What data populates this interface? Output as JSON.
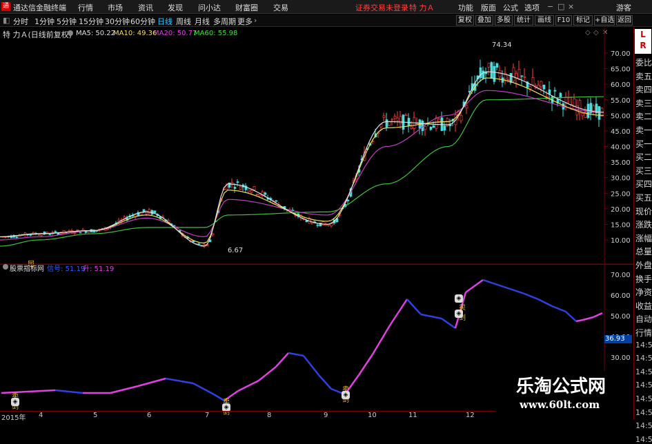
{
  "menubar": {
    "app_title": "通达信金融终端",
    "items": [
      "行情",
      "市场",
      "资讯",
      "发现",
      "问小达",
      "财富圈",
      "交易"
    ],
    "login_status": "证券交易未登录",
    "stock_name": "特 力Ａ",
    "right_items": [
      "功能",
      "版面",
      "公式",
      "选项"
    ],
    "guest": "游客"
  },
  "toolbar": {
    "periods": [
      "分时",
      "1分钟",
      "5分钟",
      "15分钟",
      "30分钟",
      "60分钟",
      "日线",
      "周线",
      "月线",
      "多周期",
      "更多"
    ],
    "active_period": "日线",
    "right_buttons": [
      "复权",
      "叠加",
      "多股",
      "统计",
      "画线",
      "F10",
      "标记",
      "+自选",
      "返回"
    ]
  },
  "main_chart": {
    "title": "特 力Ａ(日线前复权)",
    "ma_labels": [
      {
        "text": "MA5: 50.22",
        "color": "#e0e0e0"
      },
      {
        "text": "MA10: 49.36",
        "color": "#f0e060"
      },
      {
        "text": "MA20: 50.77",
        "color": "#e040e0"
      },
      {
        "text": "MA60: 55.98",
        "color": "#40e040"
      }
    ],
    "y_ticks": [
      "70.00",
      "65.00",
      "60.00",
      "55.00",
      "50.00",
      "45.00",
      "40.00",
      "35.00",
      "30.00",
      "25.00",
      "20.00",
      "15.00",
      "10.00"
    ],
    "high_label": "74.34",
    "low_label": "6.67",
    "marker": "屈"
  },
  "indicator": {
    "title": "股票指标网",
    "line1": "信号: 51.19",
    "line2": "升: 51.19",
    "y_ticks": [
      "70.00",
      "60.00",
      "50.00",
      "40.00",
      "30.00"
    ],
    "current_value": "36.93",
    "buy_label": "买",
    "sell_label": "卖剑"
  },
  "right_panel": {
    "items": [
      "委比",
      "卖五",
      "卖四",
      "卖三",
      "卖二",
      "卖一",
      "买一",
      "买二",
      "买三",
      "买四",
      "买五",
      "现价",
      "涨跌",
      "涨幅",
      "总量",
      "外盘",
      "换手",
      "净资",
      "收益",
      "自动",
      "行情",
      "14:5",
      "14:5",
      "14:5",
      "14:5",
      "14:5",
      "14:5",
      "14:5",
      "14:5"
    ],
    "logo_letter": "L",
    "logo_letter2": "R"
  },
  "x_axis": {
    "labels": [
      "2015年",
      "4",
      "5",
      "6",
      "7",
      "8",
      "9",
      "10",
      "11",
      "12"
    ]
  },
  "watermark": {
    "line1": "乐淘公式网",
    "line2": "www.60lt.com"
  },
  "colors": {
    "up": "#ff4040",
    "down": "#40e0e0",
    "ma5": "#e0e0e0",
    "ma10": "#f0e060",
    "ma20": "#c040c0",
    "ma60": "#40c040",
    "ind_up": "#e040e0",
    "ind_down": "#3040e0",
    "axis": "#7a0000"
  },
  "chart_data": {
    "type": "line",
    "title": "特 力Ａ(日线前复权)",
    "x": [
      "2015年",
      "4",
      "5",
      "6",
      "7",
      "8",
      "9",
      "10",
      "11",
      "12"
    ],
    "series": [
      {
        "name": "MA5",
        "values": [
          11,
          12,
          13,
          19,
          8,
          28,
          15,
          48,
          47,
          64,
          51
        ]
      },
      {
        "name": "MA10",
        "values": [
          11,
          12,
          13,
          18,
          9,
          26,
          16,
          46,
          48,
          62,
          50
        ]
      },
      {
        "name": "MA20",
        "values": [
          10,
          11,
          13,
          17,
          11,
          23,
          18,
          40,
          50,
          58,
          51
        ]
      },
      {
        "name": "MA60",
        "values": [
          8,
          10,
          12,
          14,
          14,
          18,
          19,
          28,
          40,
          55,
          56
        ]
      }
    ],
    "ylim": [
      5,
      75
    ],
    "high": 74.34,
    "low": 6.67
  }
}
